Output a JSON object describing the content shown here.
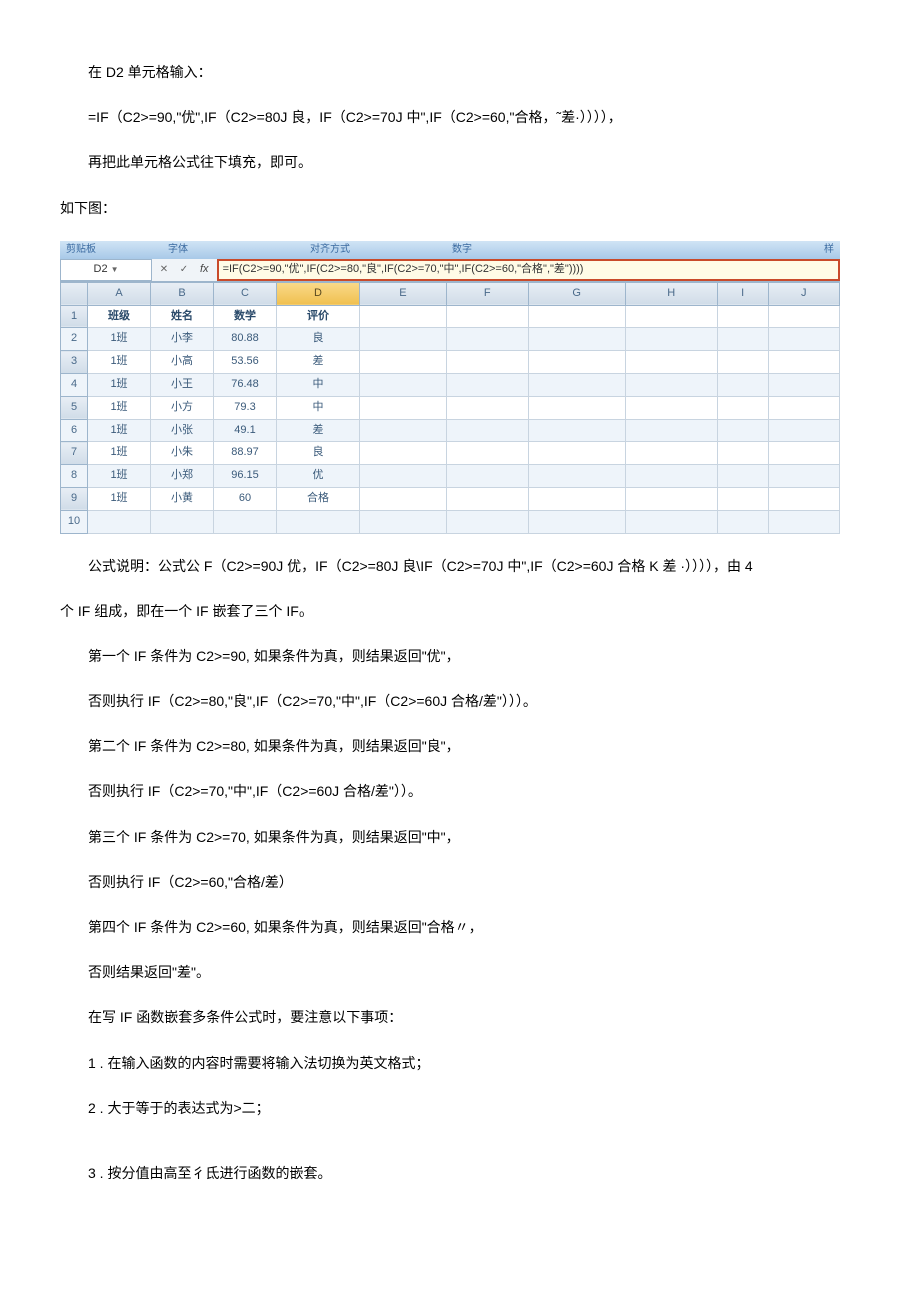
{
  "intro": {
    "line1": "在 D2 单元格输入：",
    "line2": "=IF（C2>=90,\"优\",IF（C2>=80J 良，IF（C2>=70J 中\",IF（C2>=60,\"合格，˜差·）））），",
    "line3": "再把此单元格公式往下填充，即可。",
    "line4": "如下图："
  },
  "ribbon": {
    "item1": "剪贴板",
    "item2": "字体",
    "item3": "对齐方式",
    "item4": "数字",
    "item5": "样"
  },
  "formula_bar": {
    "cell_ref": "D2",
    "fx": "fx",
    "formula": "=IF(C2>=90,\"优\",IF(C2>=80,\"良\",IF(C2>=70,\"中\",IF(C2>=60,\"合格\",\"差\"))))"
  },
  "columns": [
    "A",
    "B",
    "C",
    "D",
    "E",
    "F",
    "G",
    "H",
    "I",
    "J"
  ],
  "rows": [
    "1",
    "2",
    "3",
    "4",
    "5",
    "6",
    "7",
    "8",
    "9",
    "10"
  ],
  "headers": {
    "a": "班级",
    "b": "姓名",
    "c": "数学",
    "d": "评价"
  },
  "data": [
    {
      "a": "1班",
      "b": "小李",
      "c": "80.88",
      "d": "良"
    },
    {
      "a": "1班",
      "b": "小高",
      "c": "53.56",
      "d": "差"
    },
    {
      "a": "1班",
      "b": "小王",
      "c": "76.48",
      "d": "中"
    },
    {
      "a": "1班",
      "b": "小方",
      "c": "79.3",
      "d": "中"
    },
    {
      "a": "1班",
      "b": "小张",
      "c": "49.1",
      "d": "差"
    },
    {
      "a": "1班",
      "b": "小朱",
      "c": "88.97",
      "d": "良"
    },
    {
      "a": "1班",
      "b": "小郑",
      "c": "96.15",
      "d": "优"
    },
    {
      "a": "1班",
      "b": "小黄",
      "c": "60",
      "d": "合格"
    }
  ],
  "explain": {
    "p1": "公式说明：公式公 F（C2>=90J 优，IF（C2>=80J 良\\IF（C2>=70J 中\",IF（C2>=60J 合格 K 差 ·）））），由 4",
    "p2": "个 IF 组成，即在一个 IF 嵌套了三个 IF₀",
    "p3": "第一个 IF 条件为 C2>=90, 如果条件为真，则结果返回\"优\"，",
    "p4": "否则执行 IF（C2>=80,\"良\",IF（C2>=70,\"中\",IF（C2>=60J 合格/差\"）））。",
    "p5": "第二个 IF 条件为 C2>=80, 如果条件为真，则结果返回\"良\"，",
    "p6": "否则执行 IF（C2>=70,\"中\",IF（C2>=60J 合格/差\"））。",
    "p7": "第三个 IF 条件为 C2>=70, 如果条件为真，则结果返回\"中\"，",
    "p8": "否则执行 IF（C2>=60,\"合格/差）",
    "p9": "第四个 IF 条件为 C2>=60, 如果条件为真，则结果返回\"合格〃，",
    "p10": "否则结果返回\"差\"。",
    "p11": "在写 IF 函数嵌套多条件公式时，要注意以下事项：",
    "p12": "1 . 在输入函数的内容时需要将输入法切换为英文格式；",
    "p13": "2 . 大于等于的表达式为>二；",
    "p14": "3 . 按分值由高至彳氐进行函数的嵌套。"
  }
}
